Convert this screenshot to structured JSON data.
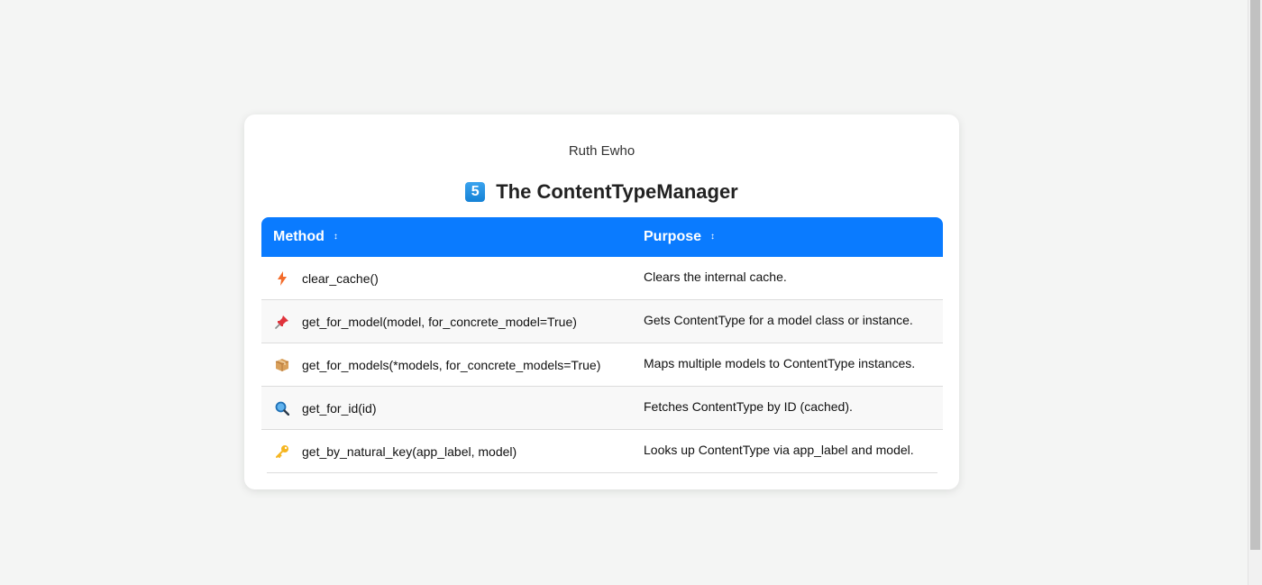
{
  "card": {
    "author": "Ruth Ewho",
    "number_badge": "5",
    "title": "The ContentTypeManager"
  },
  "table": {
    "headers": {
      "method": "Method",
      "purpose": "Purpose",
      "sort_icon": "↕"
    },
    "rows": [
      {
        "icon": "lightning-icon",
        "method": "clear_cache()",
        "purpose": "Clears the internal cache."
      },
      {
        "icon": "pushpin-icon",
        "method": "get_for_model(model, for_concrete_model=True)",
        "purpose": "Gets ContentType for a model class or instance."
      },
      {
        "icon": "package-icon",
        "method": "get_for_models(*models, for_concrete_models=True)",
        "purpose": "Maps multiple models to ContentType instances."
      },
      {
        "icon": "magnifier-icon",
        "method": "get_for_id(id)",
        "purpose": "Fetches ContentType by ID (cached)."
      },
      {
        "icon": "key-icon",
        "method": "get_by_natural_key(app_label, model)",
        "purpose": "Looks up ContentType via app_label and model."
      }
    ]
  },
  "colors": {
    "header_bg": "#0a7bff",
    "badge_bg": "#1e90e6",
    "page_bg": "#f4f5f4"
  }
}
